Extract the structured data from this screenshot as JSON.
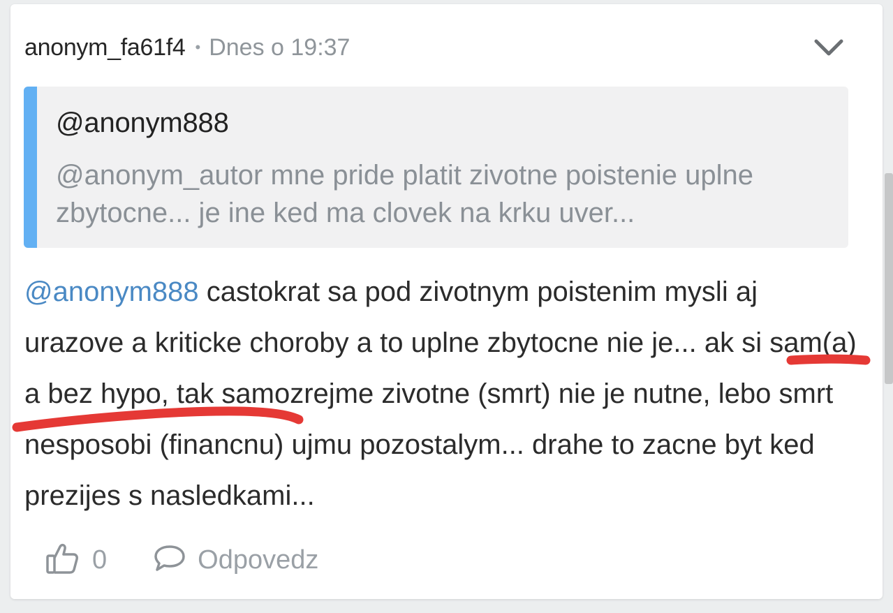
{
  "comment": {
    "username": "anonym_fa61f4",
    "separator": "•",
    "timestamp": "Dnes o 19:37",
    "quote": {
      "author": "@anonym888",
      "text": "@anonym_autor mne pride platit zivotne poistenie uplne zbytocne... je ine ked ma clovek na krku uver..."
    },
    "body": {
      "mention": "@anonym888",
      "text": " castokrat sa pod zivotnym poistenim mysli aj urazove a kriticke choroby a to uplne zbytocne nie je... ak si sam(a) a bez hypo, tak samozrejme zivotne (smrt) nie je nutne, lebo smrt nesposobi (financnu) ujmu pozostalym... drahe to zacne byt ked prezijes s nasledkami..."
    },
    "actions": {
      "like_count": "0",
      "reply_label": "Odpovedz"
    }
  },
  "icons": {
    "expand": "chevron-down-icon",
    "like": "thumbs-up-icon",
    "reply": "speech-bubble-icon"
  },
  "colors": {
    "quote_bar": "#62b0f3",
    "mention": "#4a89c4",
    "annotation": "#e53935"
  }
}
